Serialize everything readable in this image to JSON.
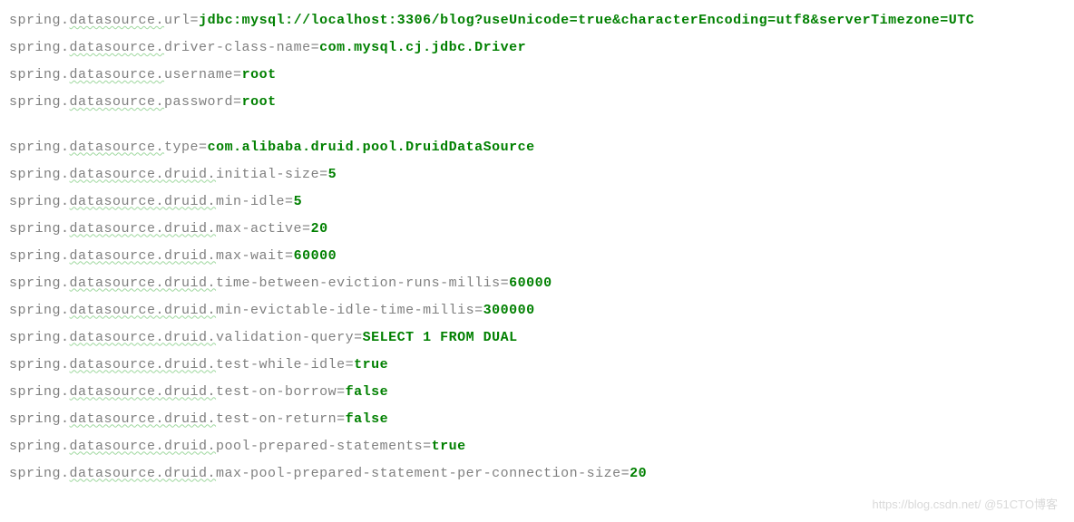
{
  "lines": [
    {
      "prefix": "spring.",
      "wavy": "datasource.",
      "rest": "url=",
      "value": "jdbc:mysql://localhost:3306/blog?useUnicode=true&characterEncoding=utf8&serverTimezone=UTC",
      "bold": true
    },
    {
      "prefix": "spring.",
      "wavy": "datasource.",
      "rest": "driver-class-name=",
      "value": "com.mysql.cj.jdbc.Driver",
      "bold": true
    },
    {
      "prefix": "spring.",
      "wavy": "datasource.",
      "rest": "username=",
      "value": "root",
      "bold": true
    },
    {
      "prefix": "spring.",
      "wavy": "datasource.",
      "rest": "password=",
      "value": "root",
      "bold": true
    },
    {
      "blank": true
    },
    {
      "prefix": "spring.",
      "wavy": "datasource.",
      "rest": "type=",
      "value": "com.alibaba.druid.pool.DruidDataSource",
      "bold": true
    },
    {
      "prefix": "spring.",
      "wavy": "datasource.druid.",
      "rest": "initial-size=",
      "value": "5",
      "bold": true
    },
    {
      "prefix": "spring.",
      "wavy": "datasource.druid.",
      "rest": "min-idle=",
      "value": "5",
      "bold": true
    },
    {
      "prefix": "spring.",
      "wavy": "datasource.druid.",
      "rest": "max-active=",
      "value": "20",
      "bold": true
    },
    {
      "prefix": "spring.",
      "wavy": "datasource.druid.",
      "rest": "max-wait=",
      "value": "60000",
      "bold": true
    },
    {
      "prefix": "spring.",
      "wavy": "datasource.druid.",
      "rest": "time-between-eviction-runs-millis=",
      "value": "60000",
      "bold": true
    },
    {
      "prefix": "spring.",
      "wavy": "datasource.druid.",
      "rest": "min-evictable-idle-time-millis=",
      "value": "300000",
      "bold": true
    },
    {
      "prefix": "spring.",
      "wavy": "datasource.druid.",
      "rest": "validation-query=",
      "value": "SELECT 1 FROM DUAL",
      "bold": true
    },
    {
      "prefix": "spring.",
      "wavy": "datasource.druid.",
      "rest": "test-while-idle=",
      "value": "true",
      "bold": true
    },
    {
      "prefix": "spring.",
      "wavy": "datasource.druid.",
      "rest": "test-on-borrow=",
      "value": "false",
      "bold": true
    },
    {
      "prefix": "spring.",
      "wavy": "datasource.druid.",
      "rest": "test-on-return=",
      "value": "false",
      "bold": true
    },
    {
      "prefix": "spring.",
      "wavy": "datasource.druid.",
      "rest": "pool-prepared-statements=",
      "value": "true",
      "bold": true
    },
    {
      "prefix": "spring.",
      "wavy": "datasource.druid.",
      "rest": "max-pool-prepared-statement-per-connection-size=",
      "value": "20",
      "bold": true
    }
  ],
  "watermark": "https://blog.csdn.net/  @51CTO博客"
}
